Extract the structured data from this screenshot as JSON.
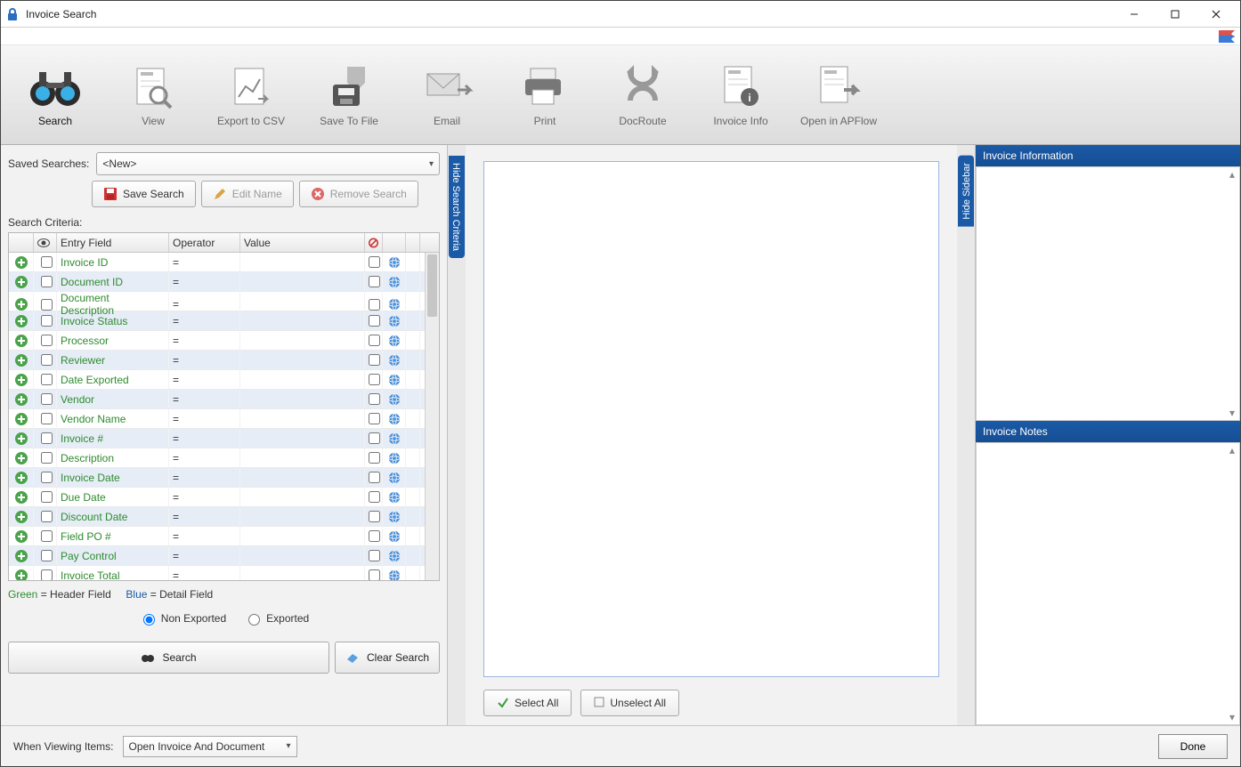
{
  "window": {
    "title": "Invoice Search"
  },
  "toolbar": {
    "search": "Search",
    "view": "View",
    "export_csv": "Export to CSV",
    "save_to_file": "Save To File",
    "email": "Email",
    "print": "Print",
    "docroute": "DocRoute",
    "invoice_info": "Invoice Info",
    "open_apflow": "Open in APFlow"
  },
  "left": {
    "saved_searches_label": "Saved Searches:",
    "saved_searches_value": "<New>",
    "save_search": "Save Search",
    "edit_name": "Edit Name",
    "remove_search": "Remove Search",
    "criteria_label": "Search Criteria:",
    "headers": {
      "entry_field": "Entry Field",
      "operator": "Operator",
      "value": "Value"
    },
    "rows": [
      {
        "field": "Invoice ID",
        "op": "="
      },
      {
        "field": "Document ID",
        "op": "="
      },
      {
        "field": "Document Description",
        "op": "="
      },
      {
        "field": "Invoice Status",
        "op": "="
      },
      {
        "field": "Processor",
        "op": "="
      },
      {
        "field": "Reviewer",
        "op": "="
      },
      {
        "field": "Date Exported",
        "op": "="
      },
      {
        "field": "Vendor",
        "op": "="
      },
      {
        "field": "Vendor Name",
        "op": "="
      },
      {
        "field": "Invoice #",
        "op": "="
      },
      {
        "field": "Description",
        "op": "="
      },
      {
        "field": "Invoice Date",
        "op": "="
      },
      {
        "field": "Due Date",
        "op": "="
      },
      {
        "field": "Discount Date",
        "op": "="
      },
      {
        "field": "Field PO #",
        "op": "="
      },
      {
        "field": "Pay Control",
        "op": "="
      },
      {
        "field": "Invoice Total",
        "op": "="
      }
    ],
    "legend_green": "Green",
    "legend_header": " = Header Field",
    "legend_blue": "Blue",
    "legend_detail": " = Detail Field",
    "non_exported": "Non Exported",
    "exported": "Exported",
    "search_btn": "Search",
    "clear_btn": "Clear Search"
  },
  "vstrips": {
    "hide_search_criteria": "Hide Search Criteria",
    "hide_sidebar": "Hide Sidebar"
  },
  "center": {
    "select_all": "Select All",
    "unselect_all": "Unselect All"
  },
  "right": {
    "info_title": "Invoice Information",
    "notes_title": "Invoice Notes"
  },
  "footer": {
    "viewing_label": "When Viewing Items:",
    "viewing_value": "Open Invoice And Document",
    "done": "Done"
  }
}
